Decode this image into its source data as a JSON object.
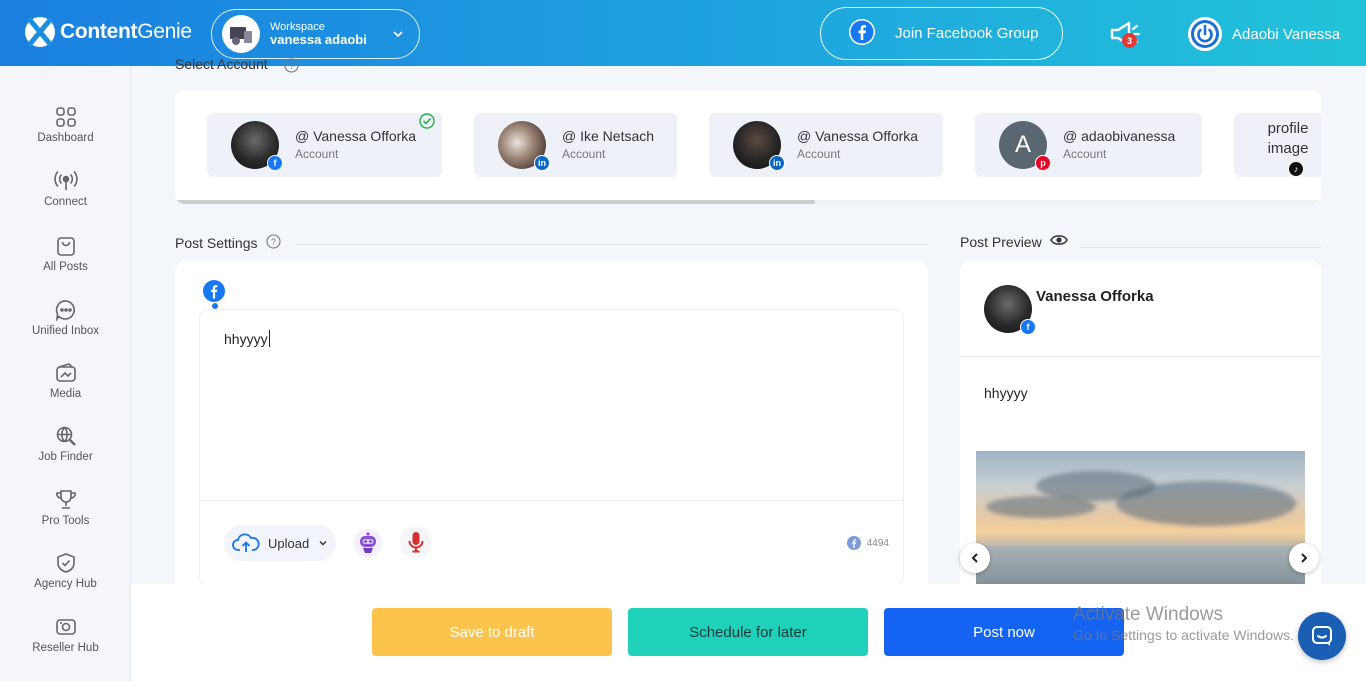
{
  "header": {
    "brand": "ContentGenie",
    "workspace_label": "Workspace",
    "workspace_name": "vanessa adaobi",
    "join_group_label": "Join Facebook Group",
    "notification_count": "3",
    "user_name": "Adaobi Vanessa"
  },
  "sidebar": {
    "items": [
      {
        "label": "Dashboard",
        "icon": "grid-icon"
      },
      {
        "label": "Connect",
        "icon": "broadcast-icon"
      },
      {
        "label": "All Posts",
        "icon": "bag-icon"
      },
      {
        "label": "Unified Inbox",
        "icon": "chat-icon"
      },
      {
        "label": "Media",
        "icon": "wallet-icon"
      },
      {
        "label": "Job Finder",
        "icon": "search-globe-icon"
      },
      {
        "label": "Pro Tools",
        "icon": "trophy-icon"
      },
      {
        "label": "Agency Hub",
        "icon": "shield-check-icon"
      },
      {
        "label": "Reseller Hub",
        "icon": "camera-icon"
      }
    ]
  },
  "accounts": {
    "section_label": "Select Account",
    "items": [
      {
        "handle": "@ Vanessa Offorka",
        "type": "Account",
        "network": "facebook",
        "selected": true
      },
      {
        "handle": "@ Ike Netsach",
        "type": "Account",
        "network": "linkedin",
        "selected": false
      },
      {
        "handle": "@ Vanessa Offorka",
        "type": "Account",
        "network": "linkedin",
        "selected": false
      },
      {
        "handle": "@ adaobivanessa",
        "type": "Account",
        "network": "pinterest",
        "initial": "A",
        "selected": false
      },
      {
        "alt_text": "profile image",
        "network": "tiktok"
      }
    ]
  },
  "post_settings": {
    "title": "Post Settings",
    "content": "hhyyyy",
    "upload_label": "Upload",
    "char_count": "4494"
  },
  "post_preview": {
    "title": "Post Preview",
    "name": "Vanessa Offorka",
    "content": "hhyyyy"
  },
  "actions": {
    "save_draft": "Save to draft",
    "schedule": "Schedule for later",
    "post_now": "Post now"
  },
  "watermark": {
    "line1": "Activate Windows",
    "line2": "Go to Settings to activate Windows."
  },
  "colors": {
    "primary": "#1463f3",
    "draft": "#fcc34d",
    "schedule": "#1fd0bb",
    "facebook": "#1877f2",
    "linkedin": "#0a66c2",
    "pinterest": "#e60023"
  }
}
